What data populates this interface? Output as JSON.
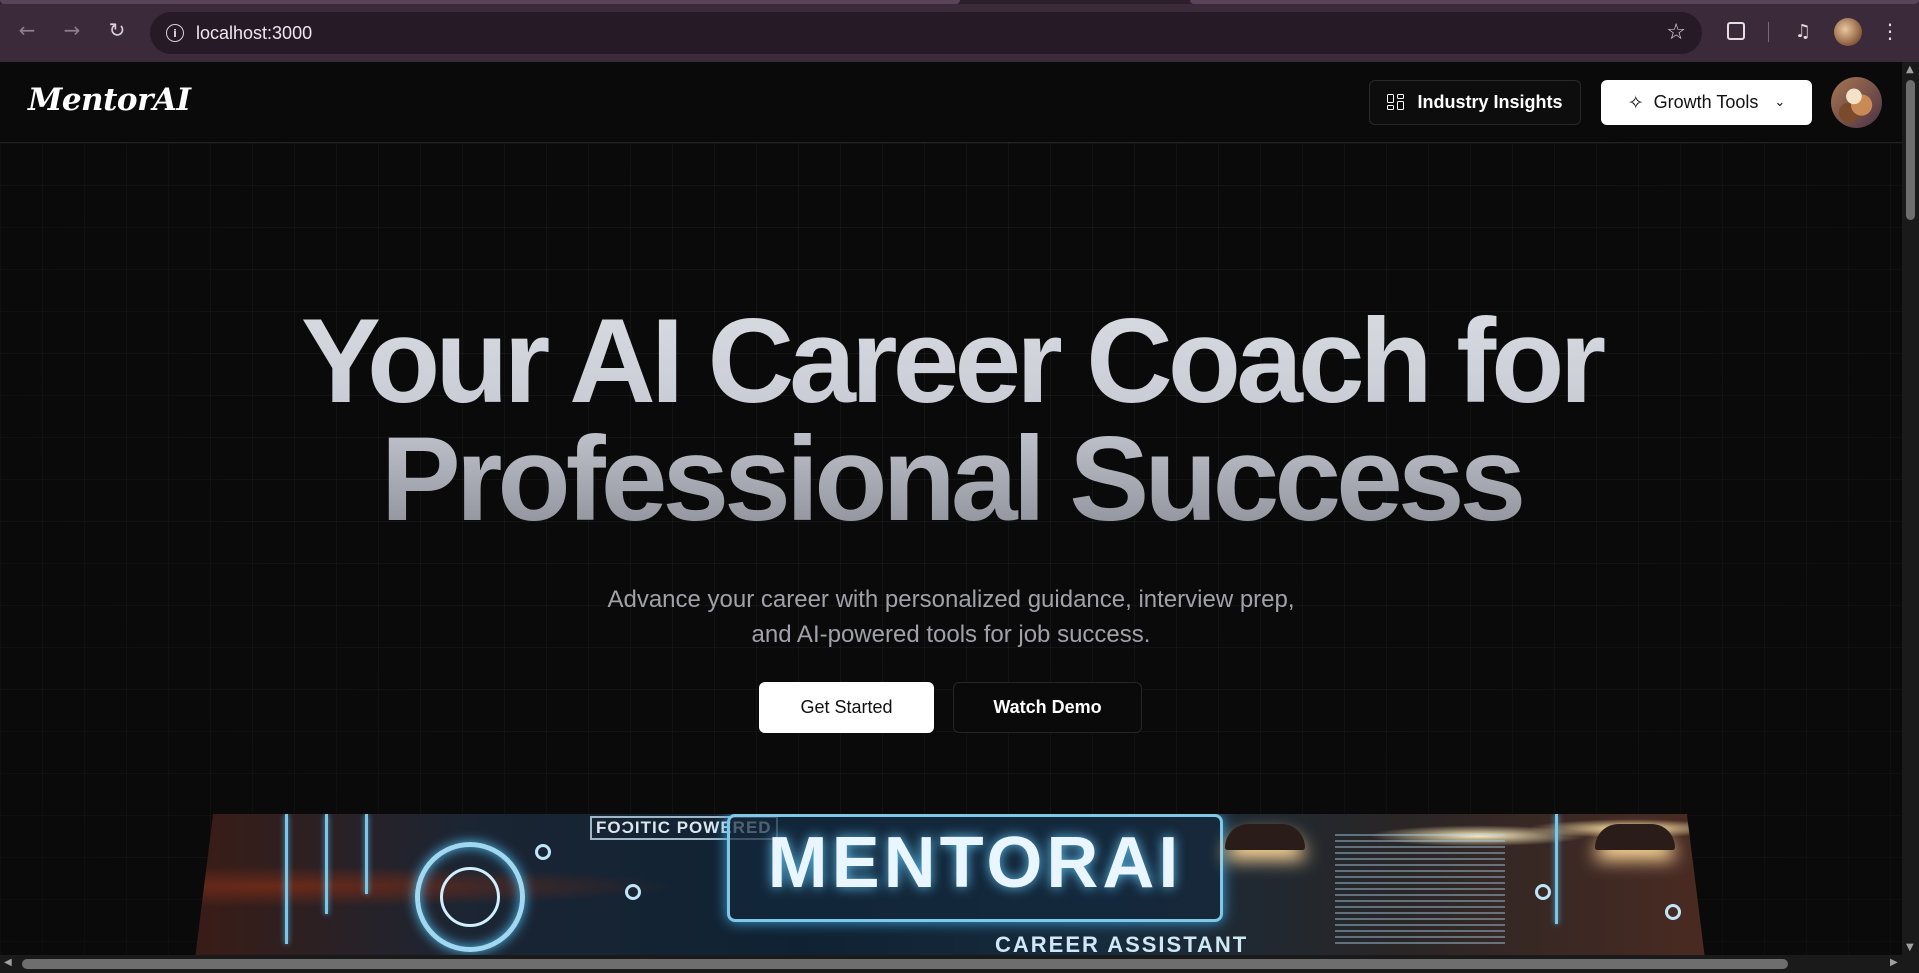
{
  "browser": {
    "url": "localhost:3000",
    "back_icon": "arrow-left-icon",
    "forward_icon": "arrow-right-icon",
    "reload_icon": "reload-icon",
    "bookmark_icon": "star-icon"
  },
  "header": {
    "logo": "MentorAI",
    "nav": {
      "insights_label": "Industry Insights",
      "growth_label": "Growth Tools"
    }
  },
  "hero": {
    "title_line1": "Your AI Career Coach for",
    "title_line2": "Professional Success",
    "subtitle": "Advance your career with personalized guidance, interview prep, and AI-powered tools for job success.",
    "primary_cta": "Get Started",
    "secondary_cta": "Watch Demo"
  },
  "banner": {
    "brand": "MENTORAI",
    "powered": "FOƆITIC POWERED",
    "sub": "CAREER ASSISTANT"
  },
  "colors": {
    "background": "#0a0a0a",
    "chrome": "#3a2a3a",
    "primary_button": "#ffffff"
  }
}
